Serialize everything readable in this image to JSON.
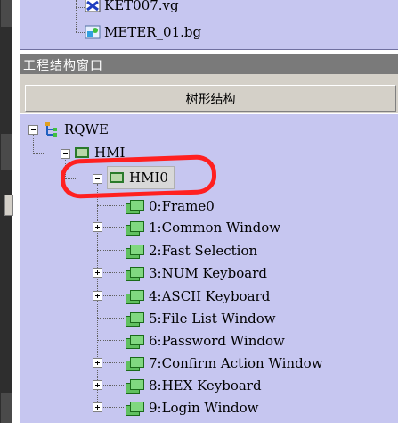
{
  "file_list": {
    "items": [
      {
        "label": "KET007.vg",
        "icon": "vector-file-icon"
      },
      {
        "label": "METER_01.bg",
        "icon": "bitmap-file-icon"
      }
    ]
  },
  "panel": {
    "title": "工程结构窗口",
    "column_header": "树形结构"
  },
  "tree": {
    "root": {
      "label": "RQWE",
      "icon": "project-icon",
      "expanded": true
    },
    "hmi": {
      "label": "HMI",
      "icon": "monitor-icon",
      "expanded": true
    },
    "hmi0": {
      "label": "HMI0",
      "icon": "monitor-icon",
      "expanded": true,
      "selected": true,
      "annotated": true
    },
    "windows": [
      {
        "label": "0:Frame0",
        "expandable": false
      },
      {
        "label": "1:Common Window",
        "expandable": true
      },
      {
        "label": "2:Fast Selection",
        "expandable": false
      },
      {
        "label": "3:NUM Keyboard",
        "expandable": true
      },
      {
        "label": "4:ASCII Keyboard",
        "expandable": true
      },
      {
        "label": "5:File List Window",
        "expandable": false
      },
      {
        "label": "6:Password Window",
        "expandable": false
      },
      {
        "label": "7:Confirm Action Window",
        "expandable": true
      },
      {
        "label": "8:HEX Keyboard",
        "expandable": true
      },
      {
        "label": "9:Login Window",
        "expandable": true
      }
    ]
  },
  "colors": {
    "tree_background": "#c6c6f0",
    "title_bar": "#7a7a7a",
    "annotation": "#ff2020"
  }
}
